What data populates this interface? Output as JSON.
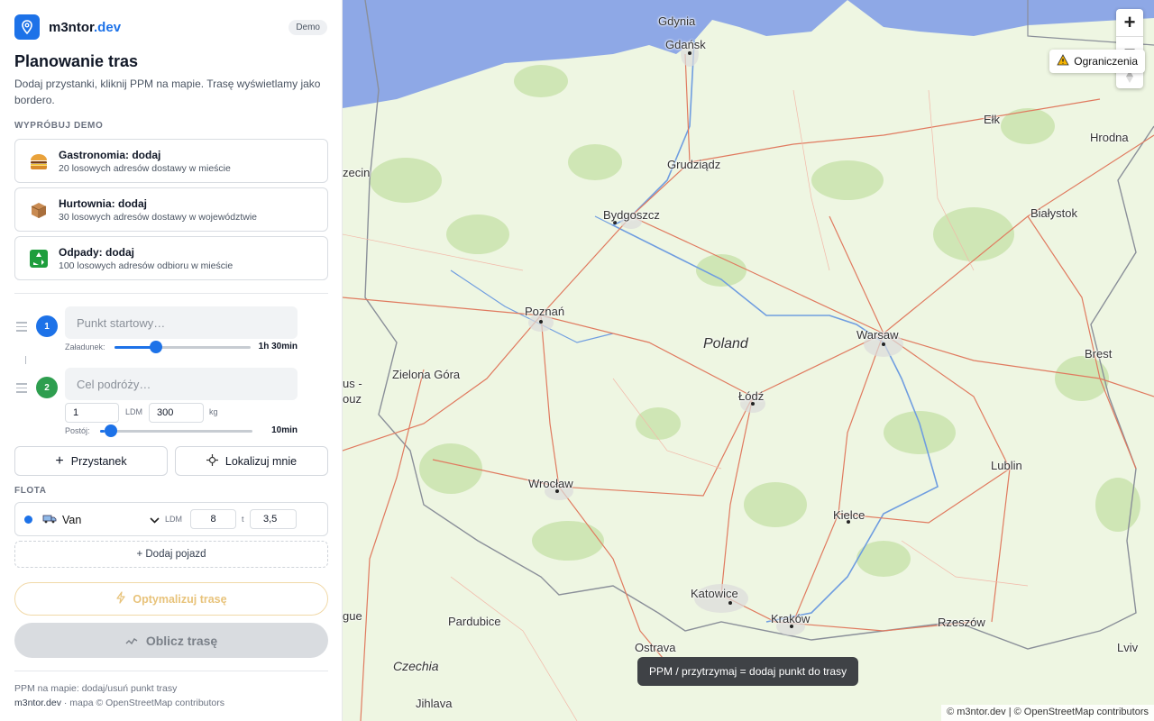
{
  "brand": {
    "name": "m3ntor",
    "tld": ".dev",
    "badge": "Demo"
  },
  "page": {
    "title": "Planowanie tras",
    "subtitle": "Dodaj przystanki, kliknij PPM na mapie. Trasę wyświetlamy jako bordero."
  },
  "demo": {
    "section_label": "WYPRÓBUJ DEMO",
    "cards": [
      {
        "title": "Gastronomia: dodaj",
        "desc": "20 losowych adresów dostawy w mieście",
        "icon": "burger-icon"
      },
      {
        "title": "Hurtownia: dodaj",
        "desc": "30 losowych adresów dostawy w województwie",
        "icon": "box-icon"
      },
      {
        "title": "Odpady: dodaj",
        "desc": "100 losowych adresów odbioru w mieście",
        "icon": "recycle-icon"
      }
    ]
  },
  "stops": [
    {
      "number": "1",
      "placeholder": "Punkt startowy…",
      "slider_label": "Załadunek:",
      "slider_value": "1h 30min",
      "slider_fraction": 0.27,
      "color": "#1d72e8"
    },
    {
      "number": "2",
      "placeholder": "Cel podróży…",
      "ldm_value": "1",
      "ldm_label": "LDM",
      "kg_value": "300",
      "kg_label": "kg",
      "slider_label": "Postój:",
      "slider_value": "10min",
      "slider_fraction": 0.03,
      "color": "#2e9e4f"
    }
  ],
  "actions": {
    "add_stop": "Przystanek",
    "locate": "Lokalizuj mnie"
  },
  "fleet": {
    "section_label": "FLOTA",
    "vehicle": {
      "name": "Van",
      "ldm_label": "LDM",
      "ldm_value": "8",
      "t_label": "t",
      "t_value": "3,5",
      "color": "#1d72e8"
    },
    "add_vehicle": "+ Dodaj pojazd"
  },
  "buttons": {
    "optimize": "Optymalizuj trasę",
    "compute": "Oblicz trasę"
  },
  "footer": {
    "hint": "PPM na mapie: dodaj/usuń punkt trasy",
    "brand": "m3ntor.dev",
    "credit": " · mapa © OpenStreetMap contributors"
  },
  "map": {
    "zoom_in": "+",
    "zoom_out": "−",
    "restrictions": "Ograniczenia",
    "toast": "PPM / przytrzymaj = dodaj punkt do trasy",
    "attribution": "© m3ntor.dev | © OpenStreetMap contributors",
    "country_labels": {
      "poland": "Poland",
      "czechia": "Czechia"
    },
    "cities": {
      "gdynia": "Gdynia",
      "gdansk": "Gdańsk",
      "szczecin": "zecin",
      "grudziadz": "Grudziądz",
      "elk": "Ełk",
      "hrodna": "Hrodna",
      "bydgoszcz": "Bydgoszcz",
      "bialystok": "Białystok",
      "poznan": "Poznań",
      "warsaw": "Warsaw",
      "zielona_gora": "Zielona Góra",
      "lodz": "Łódź",
      "brest": "Brest",
      "wroclaw": "Wrocław",
      "lublin": "Lublin",
      "kielce": "Kielce",
      "katowice": "Katowice",
      "pardubice": "Pardubice",
      "krakow": "Kraków",
      "rzeszow": "Rzeszów",
      "ostrava": "Ostrava",
      "lviv": "Lviv",
      "jihlava": "Jihlava",
      "edge_left1": "us -",
      "edge_left2": "ouz",
      "edge_left3": "gue"
    }
  }
}
